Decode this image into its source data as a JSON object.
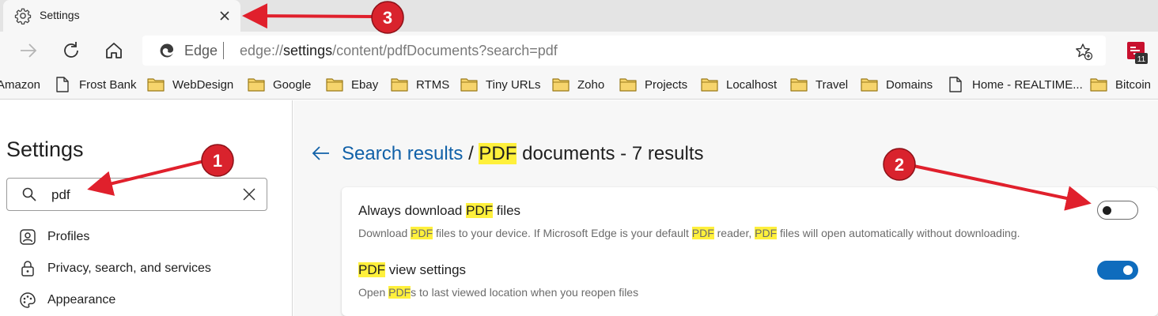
{
  "tab": {
    "title": "Settings",
    "icon": "gear-icon"
  },
  "toolbar": {
    "edge_label": "Edge",
    "url_prefix": "edge://",
    "url_host": "settings",
    "url_path": "/content/pdfDocuments?search=pdf",
    "ext_badge": "11"
  },
  "bookmarks": [
    {
      "label": "Amazon",
      "icon": "none"
    },
    {
      "label": "Frost Bank",
      "icon": "page-icon"
    },
    {
      "label": "WebDesign",
      "icon": "folder-icon"
    },
    {
      "label": "Google",
      "icon": "folder-icon"
    },
    {
      "label": "Ebay",
      "icon": "folder-icon"
    },
    {
      "label": "RTMS",
      "icon": "folder-icon"
    },
    {
      "label": "Tiny URLs",
      "icon": "folder-icon"
    },
    {
      "label": "Zoho",
      "icon": "folder-icon"
    },
    {
      "label": "Projects",
      "icon": "folder-icon"
    },
    {
      "label": "Localhost",
      "icon": "folder-icon"
    },
    {
      "label": "Travel",
      "icon": "folder-icon"
    },
    {
      "label": "Domains",
      "icon": "folder-icon"
    },
    {
      "label": "Home - REALTIME...",
      "icon": "page-icon"
    },
    {
      "label": "Bitcoin",
      "icon": "folder-icon"
    }
  ],
  "sidebar": {
    "title": "Settings",
    "search_value": "pdf",
    "items": [
      {
        "label": "Profiles",
        "icon": "profile-icon"
      },
      {
        "label": "Privacy, search, and services",
        "icon": "lock-icon"
      },
      {
        "label": "Appearance",
        "icon": "palette-icon"
      }
    ]
  },
  "main": {
    "breadcrumb_link": "Search results",
    "breadcrumb_sep": " / ",
    "heading_highlight": "PDF",
    "heading_rest": " documents - 7 results",
    "settings": [
      {
        "title_pre": "Always download ",
        "title_hl": "PDF",
        "title_post": " files",
        "desc": [
          {
            "t": "Download ",
            "hl": false
          },
          {
            "t": "PDF",
            "hl": true
          },
          {
            "t": " files to your device. If Microsoft Edge is your default ",
            "hl": false
          },
          {
            "t": "PDF",
            "hl": true
          },
          {
            "t": " reader, ",
            "hl": false
          },
          {
            "t": "PDF",
            "hl": true
          },
          {
            "t": " files will open automatically without downloading.",
            "hl": false
          }
        ],
        "enabled": false
      },
      {
        "title_pre": "",
        "title_hl": "PDF",
        "title_post": " view settings",
        "desc": [
          {
            "t": "Open ",
            "hl": false
          },
          {
            "t": "PDF",
            "hl": true
          },
          {
            "t": "s to last viewed location when you reopen files",
            "hl": false
          }
        ],
        "enabled": true
      }
    ]
  },
  "annotations": [
    {
      "number": "1"
    },
    {
      "number": "2"
    },
    {
      "number": "3"
    }
  ],
  "colors": {
    "accent": "#0f6cbd",
    "highlight": "#fff03c",
    "annotation": "#e0202c",
    "link": "#1161a8"
  }
}
